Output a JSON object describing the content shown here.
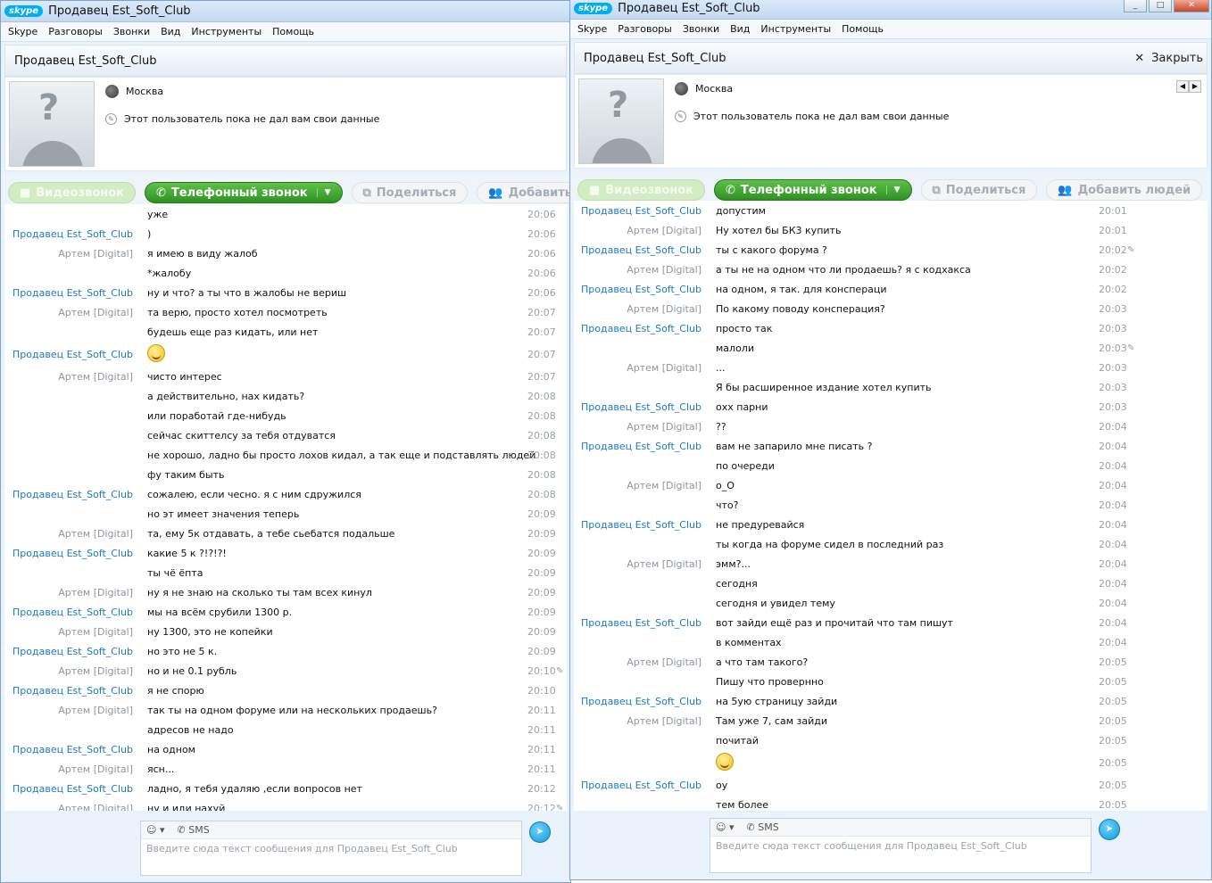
{
  "app": {
    "logo": "skype",
    "title": "Продавец Est_Soft_Club",
    "menu": [
      "Skype",
      "Разговоры",
      "Звонки",
      "Вид",
      "Инструменты",
      "Помощь"
    ]
  },
  "contact": {
    "header": "Продавец Est_Soft_Club",
    "city": "Москва",
    "status": "Этот пользователь пока не дал вам свои данные"
  },
  "close_label": "Закрыть",
  "buttons": {
    "video": "Видеозвонок",
    "phone": "Телефонный звонок",
    "share": "Поделиться",
    "add_people": "Добавить людей"
  },
  "compose": {
    "sms": "SMS",
    "placeholder": "Введите сюда текст сообщения для Продавец Est_Soft_Club"
  },
  "colors": {
    "seller": "#1d7bbf",
    "me": "#8e969e",
    "accent": "#00aff0",
    "phone_green": "#3aa52a"
  },
  "left_chat": [
    {
      "name": "",
      "text": "уже",
      "time": "20:06"
    },
    {
      "name": "Продавец Est_Soft_Club",
      "text": ")",
      "time": "20:06"
    },
    {
      "name": "Артем [Digital]",
      "text": "я имею в виду жалоб",
      "time": "20:06"
    },
    {
      "name": "",
      "text": "*жалобу",
      "time": "20:06"
    },
    {
      "name": "Продавец Est_Soft_Club",
      "text": "ну и что? а ты что в жалобы не вериш",
      "time": "20:06"
    },
    {
      "name": "Артем [Digital]",
      "text": "та верю, просто хотел посмотреть",
      "time": "20:07"
    },
    {
      "name": "",
      "text": "будешь еще раз кидать, или нет",
      "time": "20:07"
    },
    {
      "name": "Продавец Est_Soft_Club",
      "text": "",
      "time": "20:07",
      "smiley": true
    },
    {
      "name": "Артем [Digital]",
      "text": "чисто интерес",
      "time": "20:07"
    },
    {
      "name": "",
      "text": "а действительно, нах кидать?",
      "time": "20:08"
    },
    {
      "name": "",
      "text": "или поработай где-нибудь",
      "time": "20:08"
    },
    {
      "name": "",
      "text": "сейчас скиттелсу за тебя отдуватся",
      "time": "20:08"
    },
    {
      "name": "",
      "text": "не хорошо, ладно бы просто лохов кидал, а так еще и подставлять людей",
      "time": "20:08"
    },
    {
      "name": "",
      "text": "фу таким быть",
      "time": "20:08"
    },
    {
      "name": "Продавец Est_Soft_Club",
      "text": "сожалею, если чесно. я с ним сдружился",
      "time": "20:08"
    },
    {
      "name": "",
      "text": "но эт имеет значения теперь",
      "time": "20:09"
    },
    {
      "name": "Артем [Digital]",
      "text": "та, ему 5к отдавать, а тебе сьебатся подальше",
      "time": "20:09"
    },
    {
      "name": "Продавец Est_Soft_Club",
      "text": "какие 5 к ?!?!?!",
      "time": "20:09"
    },
    {
      "name": "",
      "text": "ты чё ёпта",
      "time": "20:09"
    },
    {
      "name": "Артем [Digital]",
      "text": "ну я не знаю на сколько ты там всех кинул",
      "time": "20:09"
    },
    {
      "name": "Продавец Est_Soft_Club",
      "text": "мы на всём срубили 1300 р.",
      "time": "20:09"
    },
    {
      "name": "Артем [Digital]",
      "text": "ну 1300, это не копейки",
      "time": "20:09"
    },
    {
      "name": "Продавец Est_Soft_Club",
      "text": "но это не 5 к.",
      "time": "20:09"
    },
    {
      "name": "Артем [Digital]",
      "text": "но и не 0.1 рубль",
      "time": "20:10",
      "edited": true
    },
    {
      "name": "Продавец Est_Soft_Club",
      "text": "я не спорю",
      "time": "20:10"
    },
    {
      "name": "Артем [Digital]",
      "text": "так ты на одном форуме или на нескольких продаешь?",
      "time": "20:11"
    },
    {
      "name": "",
      "text": "адресов не надо",
      "time": "20:11"
    },
    {
      "name": "Продавец Est_Soft_Club",
      "text": "на одном",
      "time": "20:11"
    },
    {
      "name": "Артем [Digital]",
      "text": "ясн...",
      "time": "20:11"
    },
    {
      "name": "Продавец Est_Soft_Club",
      "text": "ладно, я тебя удаляю ,если вопросов нет",
      "time": "20:12"
    },
    {
      "name": "Артем [Digital]",
      "text": "ну и иди нахуй",
      "time": "20:12",
      "edited": true
    }
  ],
  "right_chat": [
    {
      "name": "Продавец Est_Soft_Club",
      "text": "допустим",
      "time": "20:01"
    },
    {
      "name": "Артем [Digital]",
      "text": "Ну хотел бы БК3 купить",
      "time": "20:01"
    },
    {
      "name": "Продавец Est_Soft_Club",
      "text": "ты с какого форума ?",
      "time": "20:02",
      "edited": true
    },
    {
      "name": "Артем [Digital]",
      "text": "а ты не на одном что ли продаешь? я с кодхакса",
      "time": "20:02"
    },
    {
      "name": "Продавец Est_Soft_Club",
      "text": "на одном, я так. для конспераци",
      "time": "20:02"
    },
    {
      "name": "Артем [Digital]",
      "text": "По какому поводу конспеpация?",
      "time": "20:03"
    },
    {
      "name": "Продавец Est_Soft_Club",
      "text": "просто так",
      "time": "20:03"
    },
    {
      "name": "",
      "text": "малоли",
      "time": "20:03",
      "edited": true
    },
    {
      "name": "Артем [Digital]",
      "text": "...",
      "time": "20:03"
    },
    {
      "name": "",
      "text": "Я бы расширенное издание хотел купить",
      "time": "20:03"
    },
    {
      "name": "Продавец Est_Soft_Club",
      "text": "охх парни",
      "time": "20:03"
    },
    {
      "name": "Артем [Digital]",
      "text": "??",
      "time": "20:04"
    },
    {
      "name": "Продавец Est_Soft_Club",
      "text": "вам не запарило мне писать ?",
      "time": "20:04"
    },
    {
      "name": "",
      "text": "по очереди",
      "time": "20:04"
    },
    {
      "name": "Артем [Digital]",
      "text": "о_О",
      "time": "20:04"
    },
    {
      "name": "",
      "text": "что?",
      "time": "20:04"
    },
    {
      "name": "Продавец Est_Soft_Club",
      "text": "не предуревайся",
      "time": "20:04"
    },
    {
      "name": "",
      "text": "ты когда на форуме сидел в последний раз",
      "time": "20:04"
    },
    {
      "name": "Артем [Digital]",
      "text": "эмм?...",
      "time": "20:04"
    },
    {
      "name": "",
      "text": "сегодня",
      "time": "20:04"
    },
    {
      "name": "",
      "text": "сегодня и увидел тему",
      "time": "20:04"
    },
    {
      "name": "Продавец Est_Soft_Club",
      "text": "вот зайди ещё раз и прочитай что там пишут",
      "time": "20:04"
    },
    {
      "name": "",
      "text": "в комментах",
      "time": "20:04"
    },
    {
      "name": "Артем [Digital]",
      "text": "а что там такого?",
      "time": "20:05"
    },
    {
      "name": "",
      "text": "Пишу что провернно",
      "time": "20:05"
    },
    {
      "name": "Продавец Est_Soft_Club",
      "text": "на 5ую страницу зайди",
      "time": "20:05"
    },
    {
      "name": "Артем [Digital]",
      "text": "Там уже 7, сам зайди",
      "time": "20:05"
    },
    {
      "name": "",
      "text": "почитай",
      "time": "20:05"
    },
    {
      "name": "",
      "text": "",
      "time": "20:05",
      "smiley": true
    },
    {
      "name": "Продавец Est_Soft_Club",
      "text": "оу",
      "time": "20:05"
    },
    {
      "name": "",
      "text": "тем более",
      "time": "20:05"
    }
  ]
}
